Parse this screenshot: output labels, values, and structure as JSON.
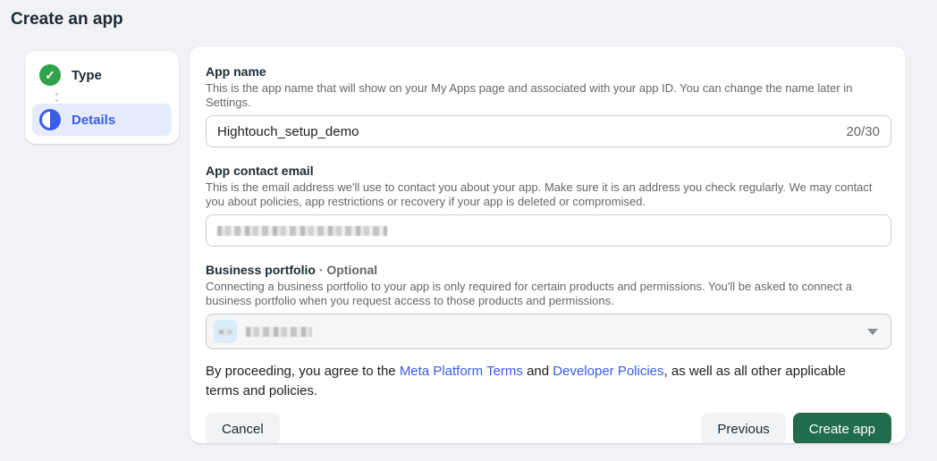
{
  "page": {
    "title": "Create an app"
  },
  "stepper": {
    "steps": [
      {
        "label": "Type",
        "state": "complete",
        "icon": "check-circle-icon"
      },
      {
        "label": "Details",
        "state": "current",
        "icon": "half-circle-icon"
      }
    ]
  },
  "form": {
    "app_name": {
      "label": "App name",
      "description": "This is the app name that will show on your My Apps page and associated with your app ID. You can change the name later in Settings.",
      "value": "Hightouch_setup_demo",
      "char_count": "20/30"
    },
    "contact_email": {
      "label": "App contact email",
      "description": "This is the email address we'll use to contact you about your app. Make sure it is an address you check regularly. We may contact you about policies, app restrictions or recovery if your app is deleted or compromised.",
      "value_state": "redacted"
    },
    "business_portfolio": {
      "label": "Business portfolio",
      "optional_label": " · Optional",
      "description": "Connecting a business portfolio to your app is only required for certain products and permissions. You'll be asked to connect a business portfolio when you request access to those products and permissions.",
      "value_state": "redacted"
    }
  },
  "terms": {
    "prefix": "By proceeding, you agree to the ",
    "link1": "Meta Platform Terms",
    "middle": " and ",
    "link2": "Developer Policies",
    "suffix": ", as well as all other applicable terms and policies."
  },
  "footer": {
    "cancel_label": "Cancel",
    "previous_label": "Previous",
    "create_label": "Create app"
  },
  "icons": {
    "check": "✓"
  },
  "colors": {
    "page_bg": "#f0f2f5",
    "accent_blue": "#3a5cf0",
    "step_current_bg": "#e6ecfc",
    "success_green": "#31a24c",
    "create_button_green": "#216c4d",
    "link_blue": "#3b5ce6",
    "desc_gray": "#65676b",
    "input_border": "#ccd0d5"
  }
}
